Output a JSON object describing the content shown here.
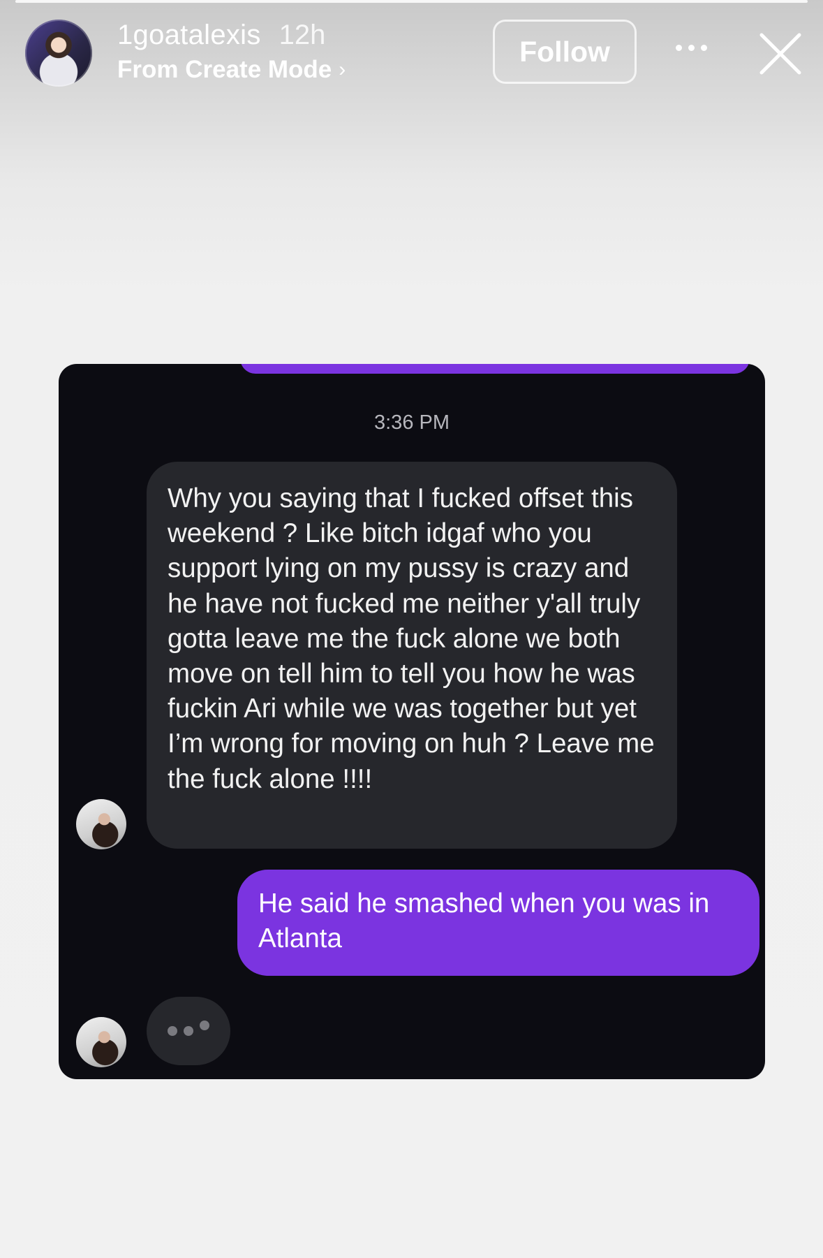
{
  "story": {
    "username": "1goatalexis",
    "time_ago": "12h",
    "subtitle": "From Create Mode",
    "subtitle_chevron": "›",
    "follow_label": "Follow",
    "icons": [
      "more-icon",
      "close-icon",
      "avatar"
    ]
  },
  "chat": {
    "timestamp": "3:36 PM",
    "incoming_message": "Why you saying that I fucked offset this weekend ? Like bitch idgaf who you support lying on my pussy is crazy and he have not fucked me neither y'all truly gotta leave me the fuck alone we both  move on tell him to tell you how he was fuckin Ari while we was together but yet I’m wrong for moving on huh ? Leave me the fuck alone !!!!",
    "outgoing_message": "He said he smashed when you was in Atlanta",
    "typing_indicator": "typing-dots",
    "colors": {
      "card_bg": "#0c0c12",
      "incoming_bubble": "#26272c",
      "outgoing_bubble": "#7b34e0"
    }
  }
}
